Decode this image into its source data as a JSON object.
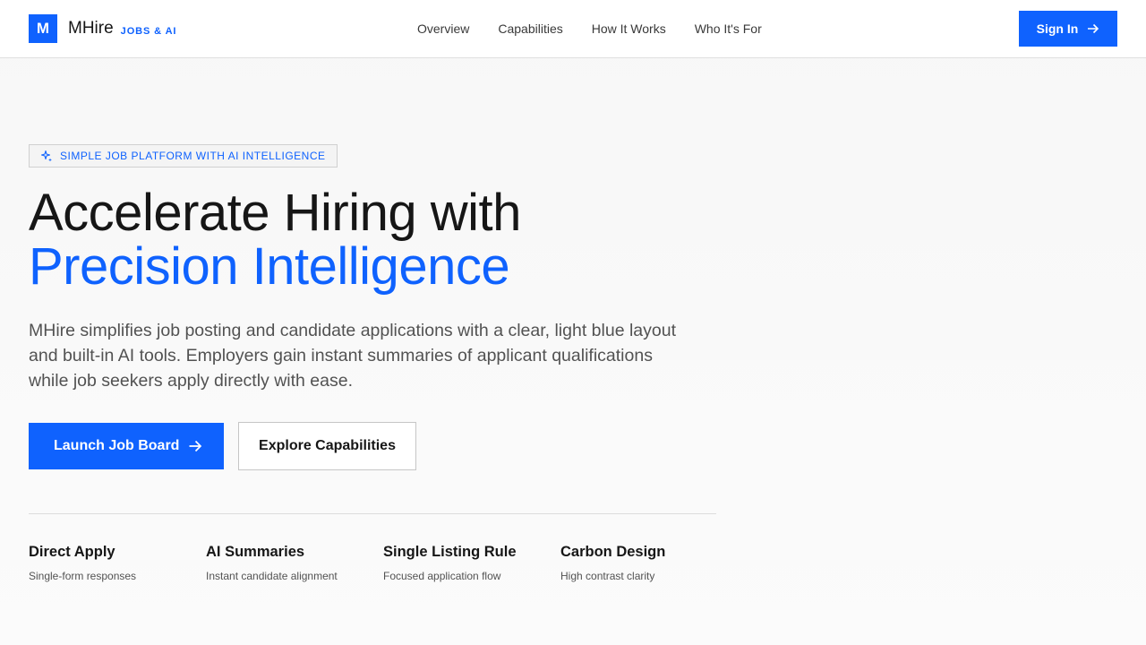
{
  "brand": {
    "logo_letter": "M",
    "name": "MHire",
    "tag": "JOBS & AI"
  },
  "nav": {
    "items": [
      {
        "label": "Overview"
      },
      {
        "label": "Capabilities"
      },
      {
        "label": "How It Works"
      },
      {
        "label": "Who It's For"
      }
    ]
  },
  "header": {
    "signin_label": "Sign In",
    "signin_icon": "arrow-right-icon"
  },
  "hero": {
    "badge_icon": "sparkle-icon",
    "badge_text": "SIMPLE JOB PLATFORM WITH AI INTELLIGENCE",
    "headline_line1": "Accelerate Hiring with",
    "headline_line2": "Precision Intelligence",
    "description": "MHire simplifies job posting and candidate applications with a clear, light blue layout and built-in AI tools. Employers gain instant summaries of applicant qualifications while job seekers apply directly with ease.",
    "primary_cta": "Launch Job Board",
    "secondary_cta": "Explore Capabilities"
  },
  "features": [
    {
      "title": "Direct Apply",
      "subtitle": "Single-form responses"
    },
    {
      "title": "AI Summaries",
      "subtitle": "Instant candidate alignment"
    },
    {
      "title": "Single Listing Rule",
      "subtitle": "Focused application flow"
    },
    {
      "title": "Carbon Design",
      "subtitle": "High contrast clarity"
    }
  ],
  "colors": {
    "accent": "#0f62fe",
    "text": "#161616",
    "muted": "#525252",
    "background": "#f7f7f7"
  }
}
